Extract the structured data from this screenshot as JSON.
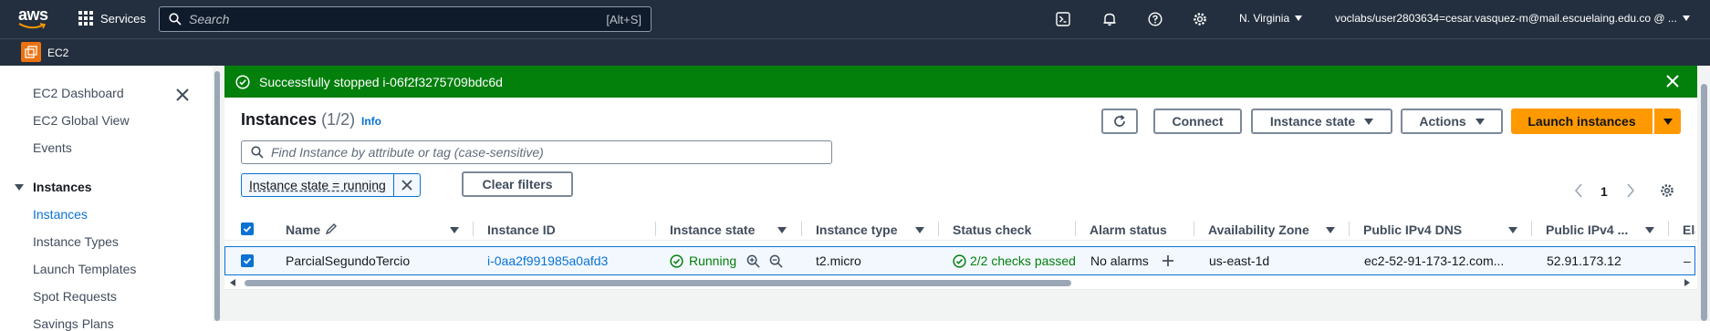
{
  "topbar": {
    "logo_text": "aws",
    "services_label": "Services",
    "search_placeholder": "Search",
    "search_shortcut": "[Alt+S]",
    "region": "N. Virginia",
    "account": "voclabs/user2803634=cesar.vasquez-m@mail.escuelaing.edu.co @ ..."
  },
  "subbar": {
    "service_label": "EC2"
  },
  "sidebar": {
    "items": [
      {
        "label": "EC2 Dashboard"
      },
      {
        "label": "EC2 Global View"
      },
      {
        "label": "Events"
      }
    ],
    "section": "Instances",
    "section_items": [
      {
        "label": "Instances",
        "active": true
      },
      {
        "label": "Instance Types"
      },
      {
        "label": "Launch Templates"
      },
      {
        "label": "Spot Requests"
      },
      {
        "label": "Savings Plans"
      }
    ]
  },
  "flash": {
    "message": "Successfully stopped i-06f2f3275709bdc6d",
    "color": "#037f0c"
  },
  "panel": {
    "title": "Instances",
    "count": "(1/2)",
    "info": "Info",
    "connect": "Connect",
    "instance_state": "Instance state",
    "actions": "Actions",
    "launch": "Launch instances",
    "find_placeholder": "Find Instance by attribute or tag (case-sensitive)",
    "filter_token": "Instance state = running",
    "clear_filters": "Clear filters",
    "page": "1",
    "accent": "#ff9900"
  },
  "table": {
    "columns": [
      "Name",
      "Instance ID",
      "Instance state",
      "Instance type",
      "Status check",
      "Alarm status",
      "Availability Zone",
      "Public IPv4 DNS",
      "Public IPv4 ...",
      "Ela"
    ],
    "row": {
      "name": "ParcialSegundoTercio",
      "instance_id": "i-0aa2f991985a0afd3",
      "state": "Running",
      "type": "t2.micro",
      "status_check": "2/2 checks passed",
      "alarm": "No alarms",
      "az": "us-east-1d",
      "dns": "ec2-52-91-173-12.com...",
      "ipv4": "52.91.173.12",
      "elastic": "–"
    }
  }
}
